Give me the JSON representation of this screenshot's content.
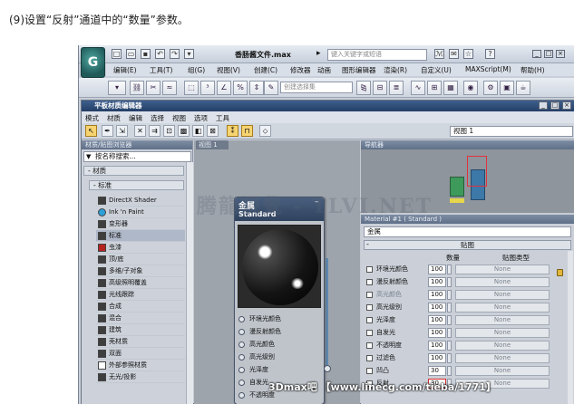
{
  "caption": "(9)设置“反射”通道中的“数量”参数。",
  "app": {
    "logo": "G",
    "file_title": "香肠酱文件.max",
    "search_placeholder": "键入关键字或短语",
    "menus": [
      "编辑(E)",
      "工具(T)",
      "组(G)",
      "视图(V)",
      "创建(C)",
      "修改器",
      "动画",
      "图形编辑器",
      "渲染(R)",
      "自定义(U)",
      "MAXScript(M)",
      "帮助(H)"
    ],
    "selection_set_placeholder": "创建选择集"
  },
  "material_editor": {
    "title": "平板材质编辑器",
    "menus": [
      "模式",
      "材质",
      "编辑",
      "选择",
      "视图",
      "选项",
      "工具"
    ],
    "view_select": "视图 1",
    "browser": {
      "header": "材质/贴图浏览器",
      "search_placeholder": "按名称搜索...",
      "category": "- 材质",
      "subcategory": "- 标准",
      "items": [
        "DirectX Shader",
        "Ink 'n Paint",
        "变形器",
        "标准",
        "虫漆",
        "顶/底",
        "多维/子对象",
        "高级照明覆盖",
        "光线跟踪",
        "合成",
        "混合",
        "建筑",
        "壳材质",
        "双面",
        "外部参照材质",
        "无光/投影"
      ]
    },
    "view1": {
      "tab": "视图 1",
      "node_name": "金属",
      "node_type": "Standard",
      "slots": [
        "环境光颜色",
        "漫反射颜色",
        "高光颜色",
        "高光级别",
        "光泽度",
        "自发光",
        "不透明度"
      ]
    },
    "navigator": {
      "header": "导航器",
      "watermark": "腾龍視覺 - TLVI.NET"
    },
    "params": {
      "header": "Material #1 ( Standard )",
      "material_name": "金属",
      "rollout_title": "贴图",
      "rollout_toggle": "-",
      "col_amount": "数量",
      "col_maptype": "贴图类型",
      "rows": [
        {
          "label": "环境光颜色",
          "amount": "100",
          "map": "None",
          "dim": false
        },
        {
          "label": "漫反射颜色",
          "amount": "100",
          "map": "None",
          "dim": false
        },
        {
          "label": "高光颜色",
          "amount": "100",
          "map": "None",
          "dim": true
        },
        {
          "label": "高光级别",
          "amount": "100",
          "map": "None",
          "dim": false
        },
        {
          "label": "光泽度",
          "amount": "100",
          "map": "None",
          "dim": false
        },
        {
          "label": "自发光",
          "amount": "100",
          "map": "None",
          "dim": false
        },
        {
          "label": "不透明度",
          "amount": "100",
          "map": "None",
          "dim": false
        },
        {
          "label": "过滤色",
          "amount": "100",
          "map": "None",
          "dim": false
        },
        {
          "label": "凹凸",
          "amount": "30",
          "map": "None",
          "dim": false
        },
        {
          "label": "反射",
          "amount": "30",
          "map": "None",
          "dim": false
        }
      ]
    }
  },
  "credit": "3Dmax吧 【www.linecg.com/tieba/1771】"
}
